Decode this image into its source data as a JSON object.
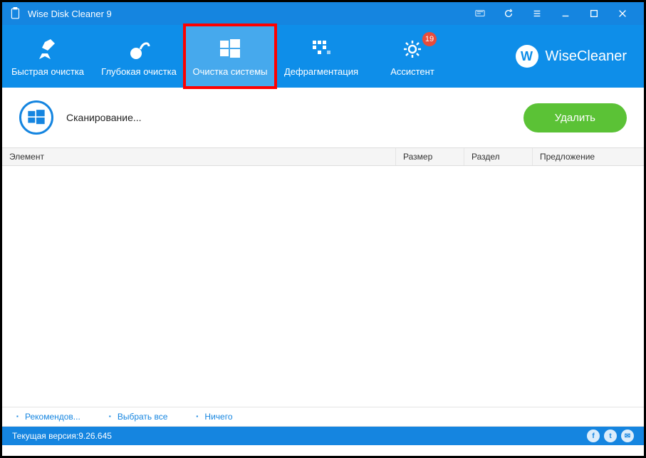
{
  "titlebar": {
    "title": "Wise Disk Cleaner 9"
  },
  "tabs": [
    {
      "id": "quick",
      "label": "Быстрая очистка"
    },
    {
      "id": "deep",
      "label": "Глубокая очистка"
    },
    {
      "id": "system",
      "label": "Очистка системы",
      "active": true
    },
    {
      "id": "defrag",
      "label": "Дефрагментация"
    },
    {
      "id": "assistant",
      "label": "Ассистент",
      "badge": "19"
    }
  ],
  "brand": "WiseCleaner",
  "status": {
    "text": "Сканирование...",
    "delete_label": "Удалить"
  },
  "columns": {
    "element": "Элемент",
    "size": "Размер",
    "partition": "Раздел",
    "suggestion": "Предложение"
  },
  "footer": {
    "recommend": "Рекомендов...",
    "select_all": "Выбрать все",
    "none": "Ничего"
  },
  "version": "Текущая версия:9.26.645"
}
